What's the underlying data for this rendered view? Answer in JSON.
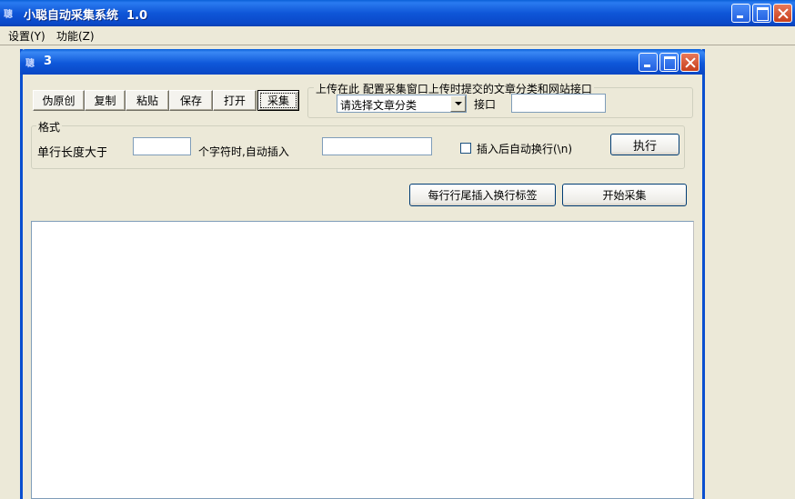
{
  "app": {
    "title": "小聪自动采集系统  1.0",
    "icon_text": "聰"
  },
  "menu": {
    "items": [
      "设置(Y)",
      "功能(Z)"
    ]
  },
  "child": {
    "title": "3",
    "icon_text": "聰"
  },
  "toolbar": {
    "buttons": [
      "伪原创",
      "复制",
      "粘贴",
      "保存",
      "打开",
      "采集"
    ],
    "focused": "采集"
  },
  "upload": {
    "legend": "上传",
    "hint": "在此 配置采集窗口上传时提交的文章分类和网站接口",
    "category_select": "请选择文章分类",
    "api_label": "接口",
    "api_value": ""
  },
  "format": {
    "legend": "格式",
    "line_length_label": "单行长度大于",
    "line_length_value": "",
    "chars_label": "个字符时,自动插入",
    "insert_value": "",
    "auto_wrap_label": "插入后自动换行(\\n)",
    "auto_wrap_checked": false,
    "execute_button": "执行"
  },
  "actions": {
    "insert_tag_button": "每行行尾插入换行标签",
    "start_button": "开始采集"
  },
  "editor": {
    "content": ""
  },
  "colors": {
    "titlebar": "#0a5fd8",
    "window_bg": "#ece9d8"
  }
}
